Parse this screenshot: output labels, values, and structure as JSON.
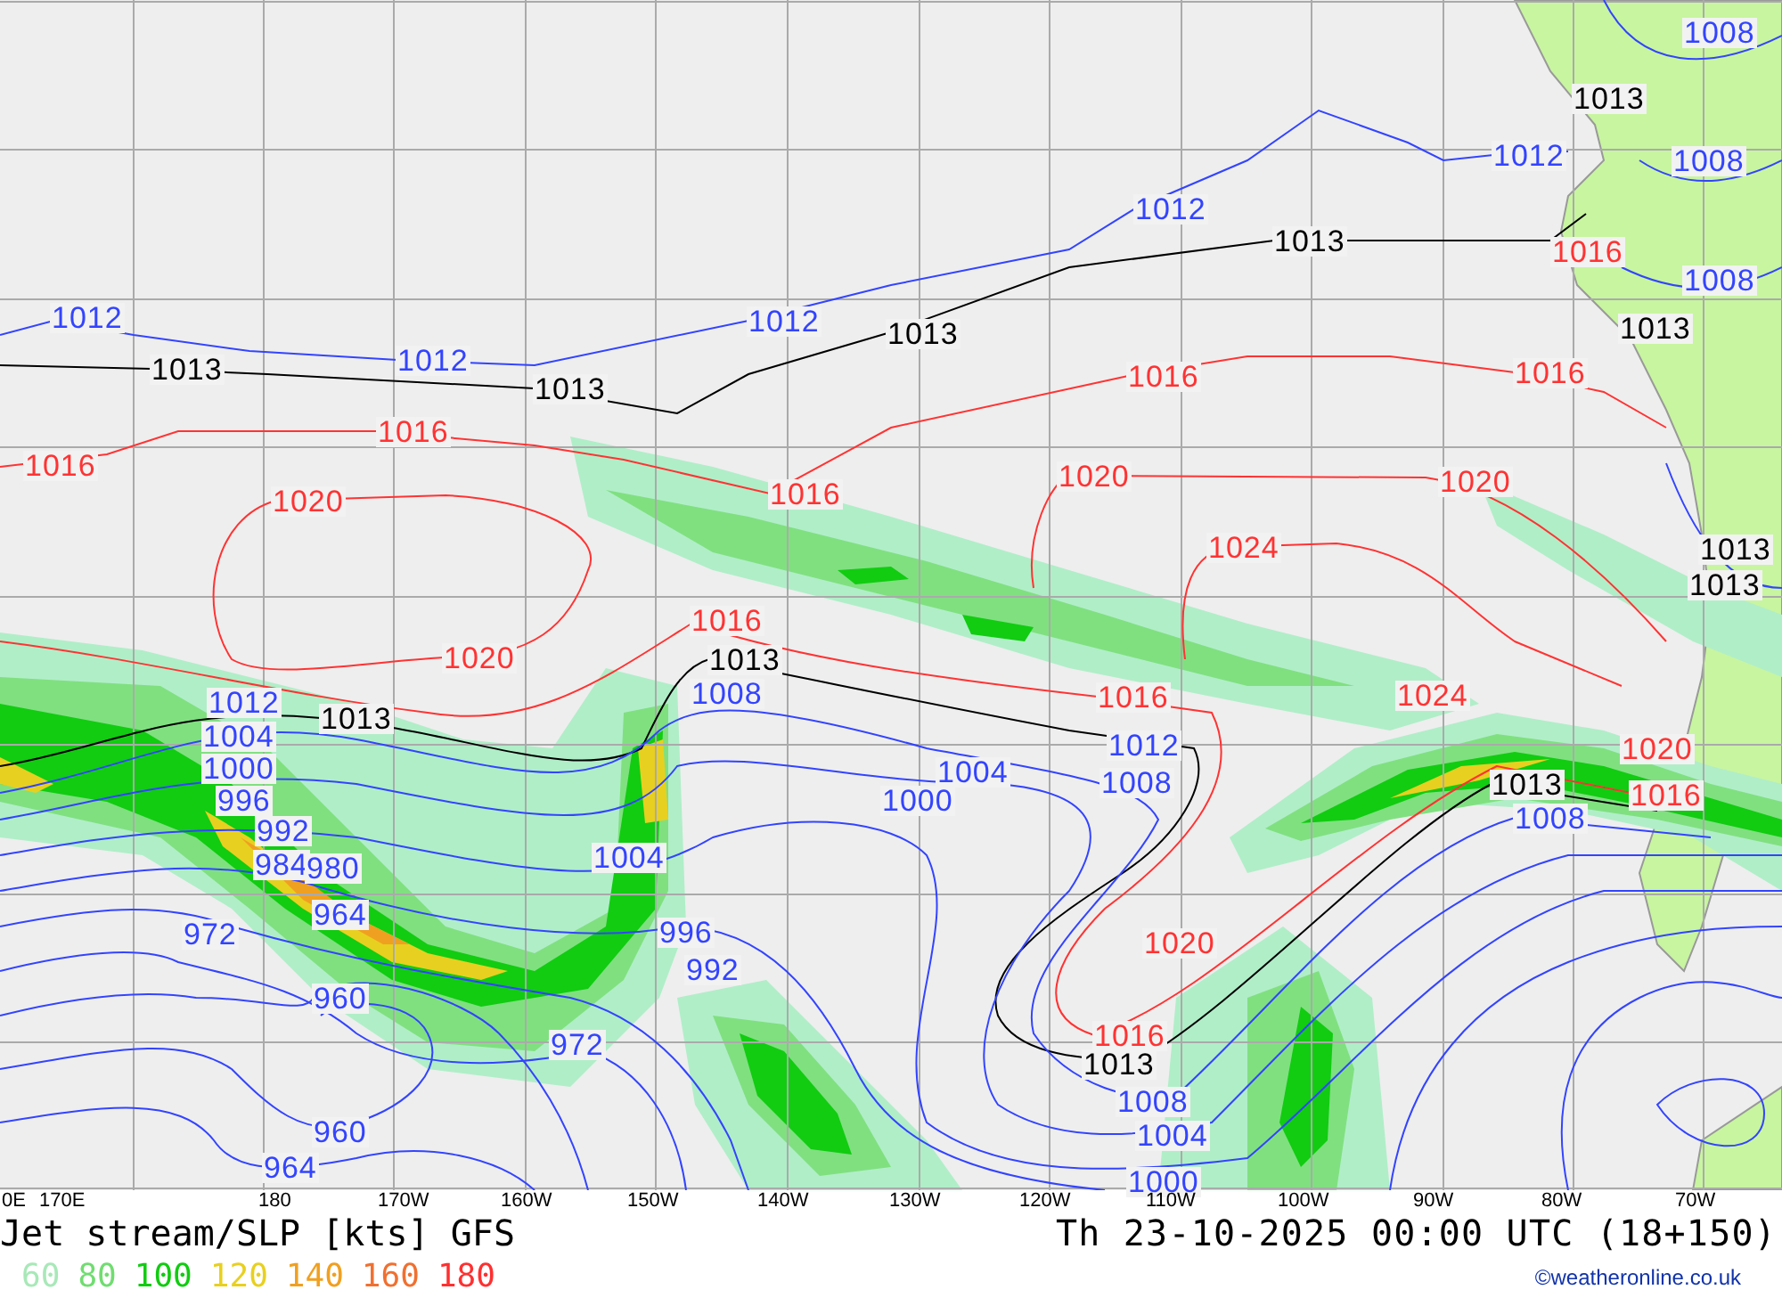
{
  "map": {
    "isobar_labels": [
      {
        "text": "1012",
        "color": "#3344ff"
      },
      {
        "text": "1013",
        "color": "#000000"
      },
      {
        "text": "1012",
        "color": "#3344ff"
      },
      {
        "text": "1013",
        "color": "#000000"
      },
      {
        "text": "1012",
        "color": "#3344ff"
      },
      {
        "text": "1013",
        "color": "#000000"
      },
      {
        "text": "1012",
        "color": "#3344ff"
      },
      {
        "text": "1013",
        "color": "#000000"
      },
      {
        "text": "1012",
        "color": "#3344ff"
      },
      {
        "text": "1013",
        "color": "#000000"
      },
      {
        "text": "1008",
        "color": "#3344ff"
      },
      {
        "text": "1008",
        "color": "#3344ff"
      },
      {
        "text": "1008",
        "color": "#3344ff"
      },
      {
        "text": "1016",
        "color": "#ff3333"
      },
      {
        "text": "1013",
        "color": "#000000"
      },
      {
        "text": "1016",
        "color": "#ff3333"
      },
      {
        "text": "1016",
        "color": "#ff3333"
      },
      {
        "text": "1016",
        "color": "#ff3333"
      },
      {
        "text": "1016",
        "color": "#ff3333"
      },
      {
        "text": "1016",
        "color": "#ff3333"
      },
      {
        "text": "1020",
        "color": "#ff3333"
      },
      {
        "text": "1020",
        "color": "#ff3333"
      },
      {
        "text": "1020",
        "color": "#ff3333"
      },
      {
        "text": "1024",
        "color": "#ff3333"
      },
      {
        "text": "1013",
        "color": "#000000"
      },
      {
        "text": "1013",
        "color": "#000000"
      },
      {
        "text": "1016",
        "color": "#ff3333"
      },
      {
        "text": "1020",
        "color": "#ff3333"
      },
      {
        "text": "1013",
        "color": "#000000"
      },
      {
        "text": "1008",
        "color": "#3344ff"
      },
      {
        "text": "1012",
        "color": "#3344ff"
      },
      {
        "text": "1013",
        "color": "#000000"
      },
      {
        "text": "1004",
        "color": "#3344ff"
      },
      {
        "text": "1000",
        "color": "#3344ff"
      },
      {
        "text": "996",
        "color": "#3344ff"
      },
      {
        "text": "992",
        "color": "#3344ff"
      },
      {
        "text": "984",
        "color": "#3344ff"
      },
      {
        "text": "980",
        "color": "#3344ff"
      },
      {
        "text": "964",
        "color": "#3344ff"
      },
      {
        "text": "972",
        "color": "#3344ff"
      },
      {
        "text": "960",
        "color": "#3344ff"
      },
      {
        "text": "972",
        "color": "#3344ff"
      },
      {
        "text": "960",
        "color": "#3344ff"
      },
      {
        "text": "964",
        "color": "#3344ff"
      },
      {
        "text": "1004",
        "color": "#3344ff"
      },
      {
        "text": "996",
        "color": "#3344ff"
      },
      {
        "text": "992",
        "color": "#3344ff"
      },
      {
        "text": "1004",
        "color": "#3344ff"
      },
      {
        "text": "1000",
        "color": "#3344ff"
      },
      {
        "text": "1016",
        "color": "#ff3333"
      },
      {
        "text": "1012",
        "color": "#3344ff"
      },
      {
        "text": "1008",
        "color": "#3344ff"
      },
      {
        "text": "1024",
        "color": "#ff3333"
      },
      {
        "text": "1020",
        "color": "#ff3333"
      },
      {
        "text": "1013",
        "color": "#000000"
      },
      {
        "text": "1016",
        "color": "#ff3333"
      },
      {
        "text": "1008",
        "color": "#3344ff"
      },
      {
        "text": "1020",
        "color": "#ff3333"
      },
      {
        "text": "1016",
        "color": "#ff3333"
      },
      {
        "text": "1013",
        "color": "#000000"
      },
      {
        "text": "1008",
        "color": "#3344ff"
      },
      {
        "text": "1004",
        "color": "#3344ff"
      },
      {
        "text": "1000",
        "color": "#3344ff"
      }
    ],
    "longitude_labels": [
      "0E",
      "170E",
      "180",
      "170W",
      "160W",
      "150W",
      "140W",
      "130W",
      "120W",
      "110W",
      "100W",
      "90W",
      "80W",
      "70W"
    ]
  },
  "title": "Jet stream/SLP [kts] GFS",
  "valid_time": "Th 23-10-2025 00:00 UTC (18+150)",
  "legend": [
    {
      "text": "60",
      "color": "#a8e8b8"
    },
    {
      "text": "80",
      "color": "#70dd70"
    },
    {
      "text": "100",
      "color": "#11cc11"
    },
    {
      "text": "120",
      "color": "#e8d020"
    },
    {
      "text": "140",
      "color": "#f0a020"
    },
    {
      "text": "160",
      "color": "#f07030"
    },
    {
      "text": "180",
      "color": "#ff3030"
    }
  ],
  "credit": "©weatheronline.co.uk"
}
